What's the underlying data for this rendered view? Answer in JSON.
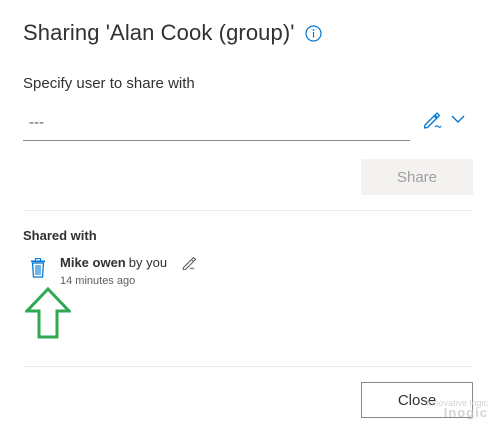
{
  "dialog": {
    "title": "Sharing 'Alan Cook (group)'",
    "specify_label": "Specify user to share with",
    "user_input": {
      "value": "",
      "placeholder": "---"
    },
    "share_button": "Share",
    "shared_with_label": "Shared with",
    "entries": [
      {
        "name": "Mike owen",
        "by": "by you",
        "time": "14 minutes ago"
      }
    ],
    "close_button": "Close"
  },
  "watermark": {
    "line1": "Inogic",
    "tagline": "Innovative logic"
  },
  "colors": {
    "accent": "#0078d4",
    "arrow": "#2fa84f",
    "text": "#323130",
    "secondary_text": "#605e5c",
    "disabled_bg": "#f3f2f1",
    "disabled_text": "#a19f9d"
  },
  "icons": {
    "info": "info-circle-icon",
    "people_picker": "people-picker-pencil-icon",
    "dropdown": "chevron-down-icon",
    "delete": "trash-icon",
    "edit": "pencil-edit-icon",
    "annotation": "up-arrow-annotation-icon"
  }
}
